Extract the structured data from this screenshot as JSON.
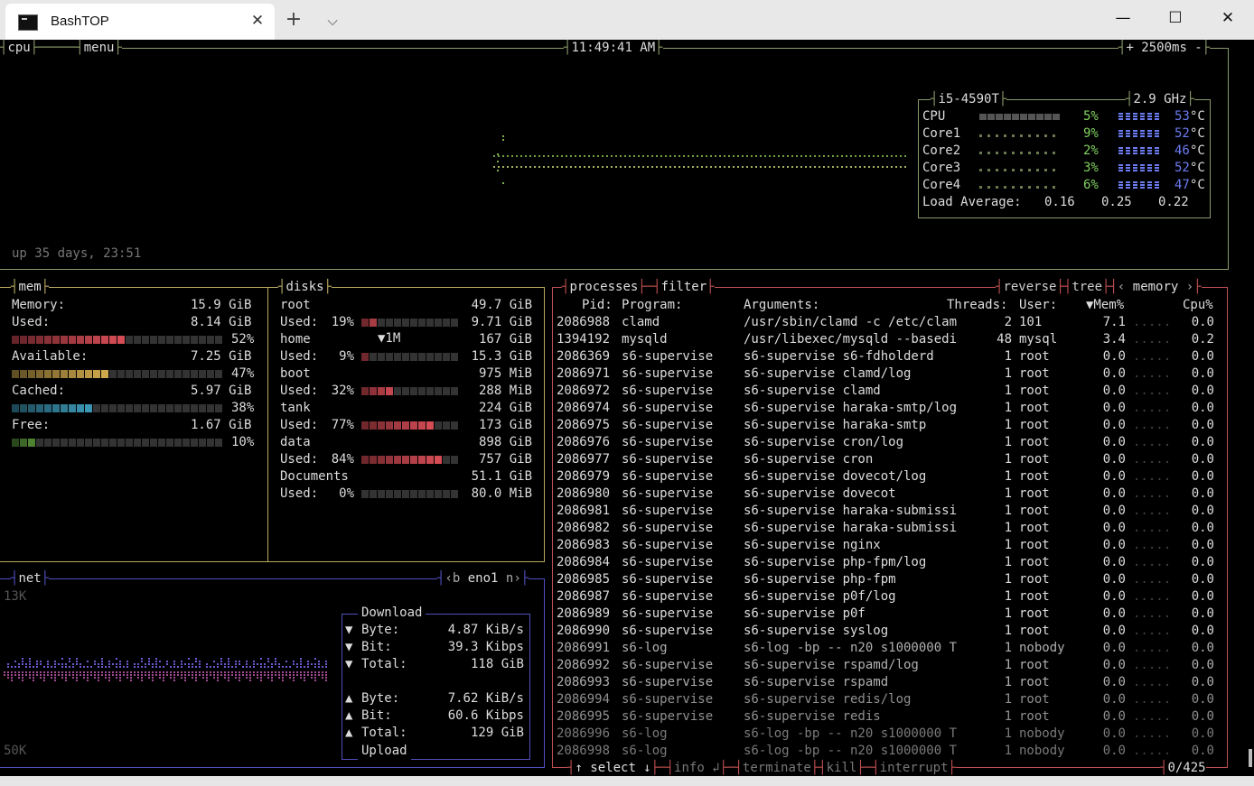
{
  "window": {
    "tab_title": "BashTOP",
    "close_tab": "✕",
    "new_tab": "+",
    "dropdown": "⌵",
    "minimize": "—",
    "maximize": "☐",
    "close": "✕"
  },
  "cpu": {
    "title": "cpu",
    "menu": "menu",
    "clock": "11:49:41 AM",
    "interval_minus_plus": "+ 2500ms -",
    "model": "i5-4590T",
    "freq": "2.9 GHz",
    "uptime": "up 35 days, 23:51",
    "rows": [
      {
        "label": "CPU",
        "pct": "5%",
        "temp": "53",
        "unit": "°C"
      },
      {
        "label": "Core1",
        "pct": "9%",
        "temp": "52",
        "unit": "°C"
      },
      {
        "label": "Core2",
        "pct": "2%",
        "temp": "46",
        "unit": "°C"
      },
      {
        "label": "Core3",
        "pct": "3%",
        "temp": "52",
        "unit": "°C"
      },
      {
        "label": "Core4",
        "pct": "6%",
        "temp": "47",
        "unit": "°C"
      }
    ],
    "load_label": "Load Average:",
    "load": [
      "0.16",
      "0.25",
      "0.22"
    ]
  },
  "mem": {
    "title": "mem",
    "rows": [
      {
        "label": "Memory:",
        "value": "15.9 GiB"
      },
      {
        "label": "Used:",
        "value": "8.14 GiB",
        "pct": "52%",
        "frac": 0.52,
        "color": "#e0505a"
      },
      {
        "label": "Available:",
        "value": "7.25 GiB",
        "pct": "47%",
        "frac": 0.47,
        "color": "#d8b050"
      },
      {
        "label": "Cached:",
        "value": "5.97 GiB",
        "pct": "38%",
        "frac": 0.38,
        "color": "#40a0c0"
      },
      {
        "label": "Free:",
        "value": "1.67 GiB",
        "pct": "10%",
        "frac": 0.1,
        "color": "#60a040"
      }
    ]
  },
  "disks": {
    "title": "disks",
    "io_label": "▼1M",
    "items": [
      {
        "name": "root",
        "total": "49.7 GiB",
        "used_label": "Used:",
        "used_pct": "19%",
        "used": "9.71 GiB",
        "frac": 0.19
      },
      {
        "name": "home",
        "total": "167 GiB",
        "used_label": "Used:",
        "used_pct": "9%",
        "used": "15.3 GiB",
        "frac": 0.09
      },
      {
        "name": "boot",
        "total": "975 MiB",
        "used_label": "Used:",
        "used_pct": "32%",
        "used": "288 MiB",
        "frac": 0.32
      },
      {
        "name": "tank",
        "total": "224 GiB",
        "used_label": "Used:",
        "used_pct": "77%",
        "used": "173 GiB",
        "frac": 0.77
      },
      {
        "name": "data",
        "total": "898 GiB",
        "used_label": "Used:",
        "used_pct": "84%",
        "used": "757 GiB",
        "frac": 0.84
      },
      {
        "name": "Documents",
        "total": "51.1 GiB",
        "used_label": "Used:",
        "used_pct": "0%",
        "used": "80.0 MiB",
        "frac": 0.0
      }
    ]
  },
  "net": {
    "title": "net",
    "prev": "‹b",
    "iface": "eno1",
    "next": "n›",
    "top_scale": "13K",
    "bottom_scale": "50K",
    "download_label": "Download",
    "upload_label": "Upload",
    "down": [
      {
        "label": "Byte:",
        "value": "4.87 KiB/s"
      },
      {
        "label": "Bit:",
        "value": "39.3 Kibps"
      },
      {
        "label": "Total:",
        "value": "118 GiB"
      }
    ],
    "up": [
      {
        "label": "Byte:",
        "value": "7.62 KiB/s"
      },
      {
        "label": "Bit:",
        "value": "60.6 Kibps"
      },
      {
        "label": "Total:",
        "value": "129 GiB"
      }
    ]
  },
  "proc": {
    "title": "processes",
    "filter": "filter",
    "reverse": "reverse",
    "tree": "tree",
    "sort": "memory",
    "headers": {
      "pid": "Pid:",
      "program": "Program:",
      "args": "Arguments:",
      "threads": "Threads:",
      "user": "User:",
      "mem": "▼Mem%",
      "cpu": "Cpu%"
    },
    "rows": [
      [
        "2086988",
        "clamd",
        "/usr/sbin/clamd -c /etc/clam",
        "2",
        "101",
        "7.1",
        "0.0"
      ],
      [
        "1394192",
        "mysqld",
        "/usr/libexec/mysqld --basedi",
        "48",
        "mysql",
        "3.4",
        "0.2"
      ],
      [
        "2086369",
        "s6-supervise",
        "s6-supervise s6-fdholderd",
        "1",
        "root",
        "0.0",
        "0.0"
      ],
      [
        "2086971",
        "s6-supervise",
        "s6-supervise clamd/log",
        "1",
        "root",
        "0.0",
        "0.0"
      ],
      [
        "2086972",
        "s6-supervise",
        "s6-supervise clamd",
        "1",
        "root",
        "0.0",
        "0.0"
      ],
      [
        "2086974",
        "s6-supervise",
        "s6-supervise haraka-smtp/log",
        "1",
        "root",
        "0.0",
        "0.0"
      ],
      [
        "2086975",
        "s6-supervise",
        "s6-supervise haraka-smtp",
        "1",
        "root",
        "0.0",
        "0.0"
      ],
      [
        "2086976",
        "s6-supervise",
        "s6-supervise cron/log",
        "1",
        "root",
        "0.0",
        "0.0"
      ],
      [
        "2086977",
        "s6-supervise",
        "s6-supervise cron",
        "1",
        "root",
        "0.0",
        "0.0"
      ],
      [
        "2086979",
        "s6-supervise",
        "s6-supervise dovecot/log",
        "1",
        "root",
        "0.0",
        "0.0"
      ],
      [
        "2086980",
        "s6-supervise",
        "s6-supervise dovecot",
        "1",
        "root",
        "0.0",
        "0.0"
      ],
      [
        "2086981",
        "s6-supervise",
        "s6-supervise haraka-submissi",
        "1",
        "root",
        "0.0",
        "0.0"
      ],
      [
        "2086982",
        "s6-supervise",
        "s6-supervise haraka-submissi",
        "1",
        "root",
        "0.0",
        "0.0"
      ],
      [
        "2086983",
        "s6-supervise",
        "s6-supervise nginx",
        "1",
        "root",
        "0.0",
        "0.0"
      ],
      [
        "2086984",
        "s6-supervise",
        "s6-supervise php-fpm/log",
        "1",
        "root",
        "0.0",
        "0.0"
      ],
      [
        "2086985",
        "s6-supervise",
        "s6-supervise php-fpm",
        "1",
        "root",
        "0.0",
        "0.0"
      ],
      [
        "2086987",
        "s6-supervise",
        "s6-supervise p0f/log",
        "1",
        "root",
        "0.0",
        "0.0"
      ],
      [
        "2086989",
        "s6-supervise",
        "s6-supervise p0f",
        "1",
        "root",
        "0.0",
        "0.0"
      ],
      [
        "2086990",
        "s6-supervise",
        "s6-supervise syslog",
        "1",
        "root",
        "0.0",
        "0.0"
      ],
      [
        "2086991",
        "s6-log",
        "s6-log -bp -- n20 s1000000 T",
        "1",
        "nobody",
        "0.0",
        "0.0"
      ],
      [
        "2086992",
        "s6-supervise",
        "s6-supervise rspamd/log",
        "1",
        "root",
        "0.0",
        "0.0"
      ],
      [
        "2086993",
        "s6-supervise",
        "s6-supervise rspamd",
        "1",
        "root",
        "0.0",
        "0.0"
      ],
      [
        "2086994",
        "s6-supervise",
        "s6-supervise redis/log",
        "1",
        "root",
        "0.0",
        "0.0"
      ],
      [
        "2086995",
        "s6-supervise",
        "s6-supervise redis",
        "1",
        "root",
        "0.0",
        "0.0"
      ],
      [
        "2086996",
        "s6-log",
        "s6-log -bp -- n20 s1000000 T",
        "1",
        "nobody",
        "0.0",
        "0.0"
      ],
      [
        "2086998",
        "s6-log",
        "s6-log -bp -- n20 s1000000 T",
        "1",
        "nobody",
        "0.0",
        "0.0"
      ]
    ],
    "footer": {
      "select": "↑ select ↓",
      "info": "info ↲",
      "terminate": "terminate",
      "kill": "kill",
      "interrupt": "interrupt",
      "count": "0/425"
    }
  },
  "colors": {
    "cpu_border": "#8a9a6a",
    "mem_border": "#b8a860",
    "net_border": "#5050c0",
    "proc_border": "#c05050",
    "pct_green": "#80d060",
    "temp_blue": "#6c7cf0"
  }
}
